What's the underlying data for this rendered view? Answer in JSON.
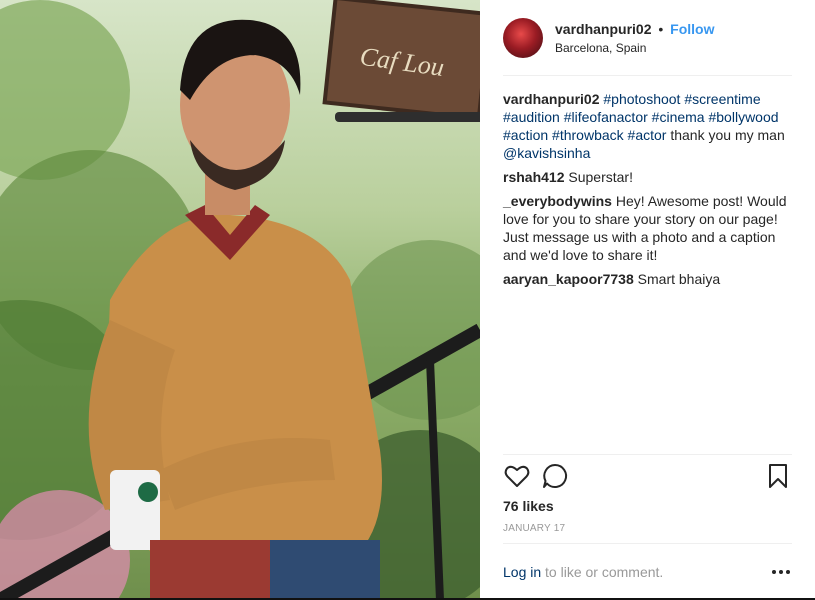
{
  "post": {
    "username": "vardhanpuri02",
    "separator": "•",
    "follow_label": "Follow",
    "location": "Barcelona, Spain"
  },
  "photo": {
    "sign_text": "Caf Lou"
  },
  "caption": {
    "username": "vardhanpuri02",
    "tags": [
      "#photoshoot",
      "#screentime",
      "#audition",
      "#lifeofanactor",
      "#cinema",
      "#bollywood",
      "#action",
      "#throwback",
      "#actor"
    ],
    "text": "thank you my man",
    "mention": "@kavishsinha"
  },
  "comments": [
    {
      "username": "rshah412",
      "text": "Superstar!"
    },
    {
      "username": "_everybodywins",
      "text": "Hey! Awesome post! Would love for you to share your story on our page! Just message us with a photo and a caption and we'd love to share it!"
    },
    {
      "username": "aaryan_kapoor7738",
      "text": "Smart bhaiya"
    }
  ],
  "actions": {
    "like_icon": "heart-icon",
    "comment_icon": "comment-icon",
    "save_icon": "bookmark-icon"
  },
  "likes": "76 likes",
  "date": "JANUARY 17",
  "login": {
    "link_label": "Log in",
    "suffix": " to like or comment."
  },
  "more_icon": "more-icon",
  "colors": {
    "link_blue": "#3897f0",
    "tag_blue": "#003569",
    "text": "#262626",
    "muted": "#999999"
  }
}
